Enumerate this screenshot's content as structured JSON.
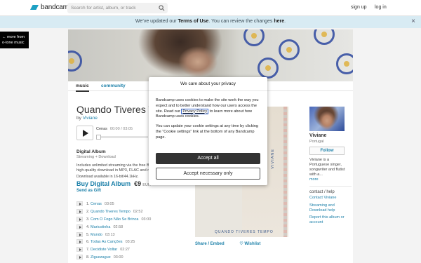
{
  "topbar": {
    "logo_text": "bandcamp",
    "search_placeholder": "Search for artist, album, or track",
    "signup": "sign up",
    "login": "log in"
  },
  "banner": {
    "pre": "We’ve updated our ",
    "terms": "Terms of Use",
    "mid": ". You can review the changes ",
    "here": "here",
    "post": ".",
    "close": "×"
  },
  "more_from": {
    "line1": "← more from",
    "line2": "o-tone music"
  },
  "tabs": {
    "music": "music",
    "community": "community"
  },
  "album": {
    "title": "Quando Tiveres Tempo",
    "by": "by",
    "artist": "Viviane",
    "now_playing": "Cenas",
    "now_time": "00:00 / 03:05",
    "progress": 0
  },
  "digital": {
    "heading": "Digital Album",
    "subheading": "Streaming + Download",
    "desc_line1": "Includes unlimited streaming via the free Bandcamp app, plus",
    "desc_line2": "high-quality download in MP3, FLAC and more.",
    "download_info": "Download available in 16-bit/44.1kHz.",
    "buy_label": "Buy Digital Album",
    "price": "€9",
    "currency": "EUR",
    "gift": "Send as Gift"
  },
  "tracks": [
    {
      "num": "1.",
      "name": "Cenas",
      "time": "03:05"
    },
    {
      "num": "2.",
      "name": "Quando Tiveres Tempo",
      "time": "02:52"
    },
    {
      "num": "3.",
      "name": "Com O Fogo Não Se Brinca",
      "time": "03:00"
    },
    {
      "num": "4.",
      "name": "Maricotinha",
      "time": "02:58"
    },
    {
      "num": "5.",
      "name": "Mundo",
      "time": "03:13"
    },
    {
      "num": "6.",
      "name": "Todas As Canções",
      "time": "03:25"
    },
    {
      "num": "7.",
      "name": "Decidiste Voltar",
      "time": "02:27"
    },
    {
      "num": "8.",
      "name": "Ziguezague",
      "time": "03:00"
    }
  ],
  "cover": {
    "vertical_text": "VIVIANE",
    "bottom_text": "QUANDO TIVERES TEMPO"
  },
  "share": {
    "share_embed": "Share / Embed",
    "wishlist": "♡ Wishlist"
  },
  "artist": {
    "name": "Viviane",
    "location": "Portugal",
    "follow": "Follow",
    "bio": "Viviane is a Portuguese singer, songwriter and flutist with a...",
    "more": "more",
    "contact_head": "contact / help",
    "contact_link": "Contact Viviane",
    "streaming_help": "Streaming and Download help",
    "report": "Report this album or account"
  },
  "cookie_modal": {
    "title": "We care about your privacy",
    "p1_pre": "Bandcamp uses cookies to make the site work the way you expect and to better understand how our users access the site. Read our ",
    "privacy_link": "Privacy Policy",
    "p1_post": " to learn more about how Bandcamp uses cookies.",
    "p2": "You can update your cookie settings at any time by clicking the “Cookie settings” link at the bottom of any Bandcamp page.",
    "accept_all": "Accept all",
    "accept_necessary": "Accept necessary only"
  }
}
